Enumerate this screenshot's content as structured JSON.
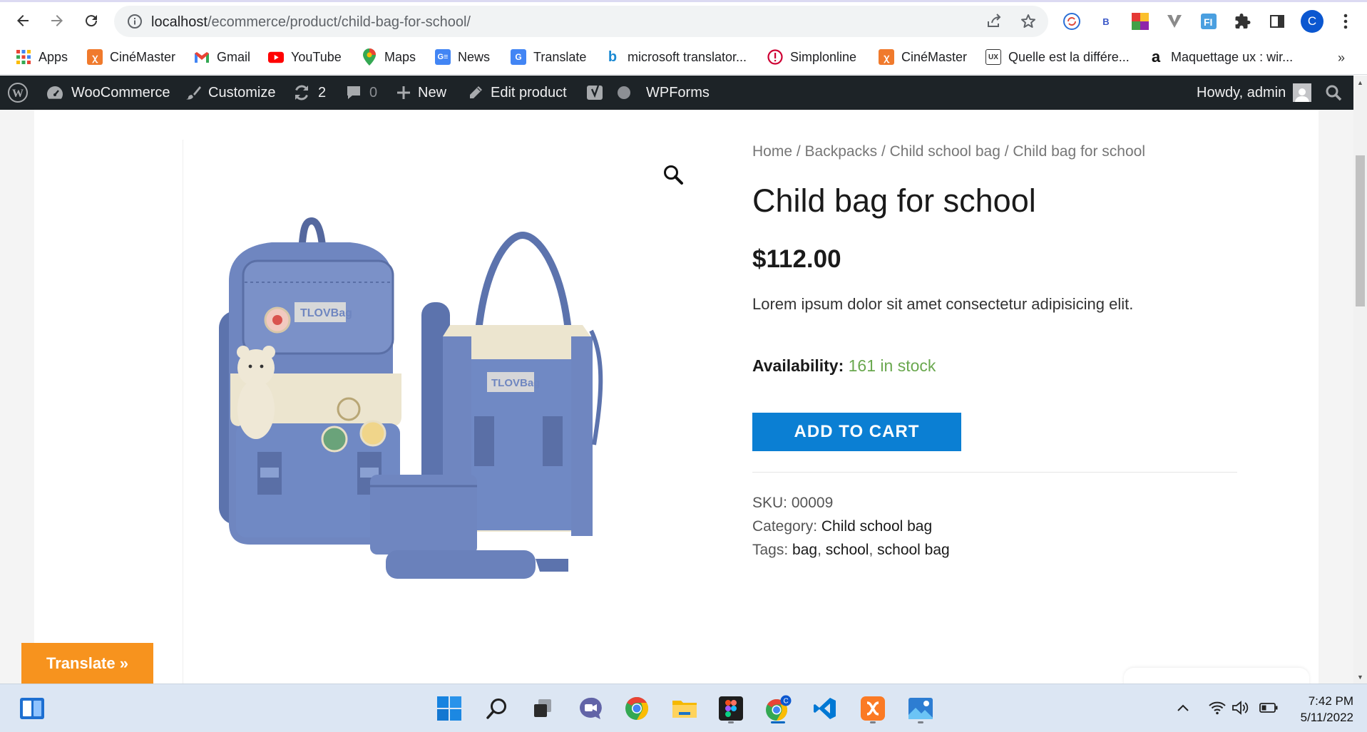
{
  "browser": {
    "url_host": "localhost",
    "url_path": "/ecommerce/product/child-bag-for-school/",
    "profile_initial": "C",
    "extensions": [
      "sync-icon",
      "b-extension-icon",
      "colorful-extension-icon",
      "v-extension-icon",
      "fi-extension-icon",
      "puzzle-icon",
      "sidepanel-icon"
    ]
  },
  "bookmarks": [
    {
      "label": "Apps",
      "icon": "apps-grid-icon"
    },
    {
      "label": "CinéMaster",
      "icon": "xampp-icon"
    },
    {
      "label": "Gmail",
      "icon": "gmail-icon"
    },
    {
      "label": "YouTube",
      "icon": "youtube-icon"
    },
    {
      "label": "Maps",
      "icon": "maps-icon"
    },
    {
      "label": "News",
      "icon": "news-icon"
    },
    {
      "label": "Translate",
      "icon": "translate-icon"
    },
    {
      "label": "microsoft translator...",
      "icon": "bing-icon"
    },
    {
      "label": "Simplonline",
      "icon": "simplonline-icon"
    },
    {
      "label": "CinéMaster",
      "icon": "xampp-icon"
    },
    {
      "label": "Quelle est la différe...",
      "icon": "ux-icon"
    },
    {
      "label": "Maquettage ux : wir...",
      "icon": "amazon-icon"
    }
  ],
  "adminbar": {
    "woocommerce": "WooCommerce",
    "customize": "Customize",
    "updates_count": "2",
    "comments_count": "0",
    "new": "New",
    "edit_product": "Edit product",
    "wpforms": "WPForms",
    "howdy": "Howdy, admin"
  },
  "product": {
    "breadcrumb": [
      "Home",
      "Backpacks",
      "Child school bag",
      "Child bag for school"
    ],
    "title": "Child bag for school",
    "price": "$112.00",
    "description": "Lorem ipsum dolor sit amet consectetur adipisicing elit.",
    "availability_label": "Availability:",
    "availability_value": "161 in stock",
    "add_to_cart": "ADD TO CART",
    "sku_label": "SKU:",
    "sku": "00009",
    "category_label": "Category:",
    "category": "Child school bag",
    "tags_label": "Tags:",
    "tags": [
      "bag",
      "school",
      "school bag"
    ],
    "badge_text": "TLOVBag",
    "colors": {
      "bag_blue": "#6f86c0",
      "bag_cream": "#ece5cf",
      "stock_green": "#6aa84f",
      "cart_blue": "#0b7fd3"
    }
  },
  "translate_widget": "Translate »",
  "taskbar": {
    "apps": [
      "widgets-icon",
      "windows-start-icon",
      "search-icon",
      "task-view-icon",
      "teams-chat-icon",
      "chrome-icon",
      "file-explorer-icon",
      "figma-icon",
      "chrome-active-icon",
      "vscode-icon",
      "xampp-icon",
      "photos-icon"
    ],
    "time": "7:42 PM",
    "date": "5/11/2022"
  }
}
